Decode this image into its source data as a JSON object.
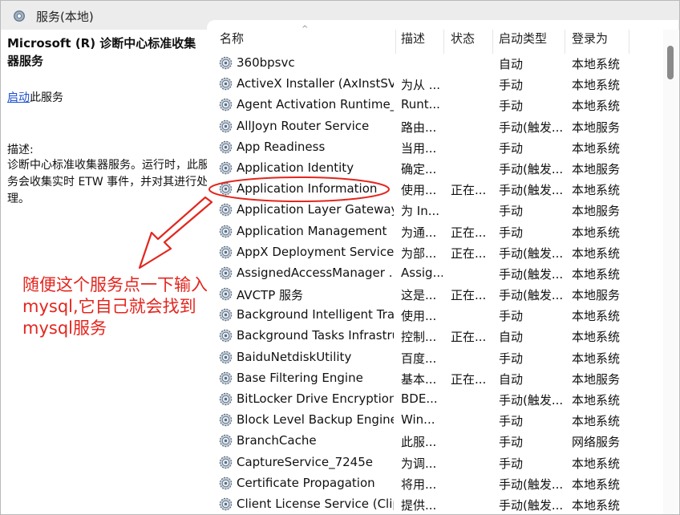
{
  "window": {
    "title": "服务(本地)"
  },
  "detail": {
    "service_title": "Microsoft (R) 诊断中心标准收集器服务",
    "start_link": "启动",
    "start_suffix": "此服务",
    "desc_label": "描述:",
    "desc_text": "诊断中心标准收集器服务。运行时，此服务会收集实时 ETW 事件，并对其进行处理。"
  },
  "columns": {
    "name": "名称",
    "desc": "描述",
    "status": "状态",
    "startup": "启动类型",
    "logon": "登录为"
  },
  "services": [
    {
      "name": "360bpsvc",
      "desc": "",
      "status": "",
      "startup": "自动",
      "logon": "本地系统"
    },
    {
      "name": "ActiveX Installer (AxInstSV)",
      "desc": "为从 ...",
      "status": "",
      "startup": "手动",
      "logon": "本地系统"
    },
    {
      "name": "Agent Activation Runtime_...",
      "desc": "Runt...",
      "status": "",
      "startup": "手动",
      "logon": "本地系统"
    },
    {
      "name": "AllJoyn Router Service",
      "desc": "路由...",
      "status": "",
      "startup": "手动(触发...",
      "logon": "本地服务"
    },
    {
      "name": "App Readiness",
      "desc": "当用...",
      "status": "",
      "startup": "手动",
      "logon": "本地系统"
    },
    {
      "name": "Application Identity",
      "desc": "确定...",
      "status": "",
      "startup": "手动(触发...",
      "logon": "本地服务"
    },
    {
      "name": "Application Information",
      "desc": "使用...",
      "status": "正在...",
      "startup": "手动(触发...",
      "logon": "本地系统"
    },
    {
      "name": "Application Layer Gateway ...",
      "desc": "为 In...",
      "status": "",
      "startup": "手动",
      "logon": "本地服务"
    },
    {
      "name": "Application Management",
      "desc": "为通...",
      "status": "正在...",
      "startup": "手动",
      "logon": "本地系统"
    },
    {
      "name": "AppX Deployment Service ...",
      "desc": "为部...",
      "status": "正在...",
      "startup": "手动(触发...",
      "logon": "本地系统"
    },
    {
      "name": "AssignedAccessManager ...",
      "desc": "Assig...",
      "status": "",
      "startup": "手动(触发...",
      "logon": "本地系统"
    },
    {
      "name": "AVCTP 服务",
      "desc": "这是...",
      "status": "正在...",
      "startup": "手动(触发...",
      "logon": "本地服务"
    },
    {
      "name": "Background Intelligent Tra...",
      "desc": "使用...",
      "status": "",
      "startup": "手动",
      "logon": "本地系统"
    },
    {
      "name": "Background Tasks Infrastru...",
      "desc": "控制...",
      "status": "正在...",
      "startup": "自动",
      "logon": "本地系统"
    },
    {
      "name": "BaiduNetdiskUtility",
      "desc": "百度...",
      "status": "",
      "startup": "手动",
      "logon": "本地系统"
    },
    {
      "name": "Base Filtering Engine",
      "desc": "基本...",
      "status": "正在...",
      "startup": "自动",
      "logon": "本地服务"
    },
    {
      "name": "BitLocker Drive Encryption ...",
      "desc": "BDE...",
      "status": "",
      "startup": "手动(触发...",
      "logon": "本地系统"
    },
    {
      "name": "Block Level Backup Engine ...",
      "desc": "Win...",
      "status": "",
      "startup": "手动",
      "logon": "本地系统"
    },
    {
      "name": "BranchCache",
      "desc": "此服...",
      "status": "",
      "startup": "手动",
      "logon": "网络服务"
    },
    {
      "name": "CaptureService_7245e",
      "desc": "为调...",
      "status": "",
      "startup": "手动",
      "logon": "本地系统"
    },
    {
      "name": "Certificate Propagation",
      "desc": "将用...",
      "status": "",
      "startup": "手动(触发...",
      "logon": "本地系统"
    },
    {
      "name": "Client License Service (Clip...",
      "desc": "提供...",
      "status": "",
      "startup": "手动(触发...",
      "logon": "本地系统"
    }
  ],
  "annotation": {
    "text": "随便这个服务点一下输入mysql,它自己就会找到mysql服务",
    "color": "#e3261e"
  }
}
